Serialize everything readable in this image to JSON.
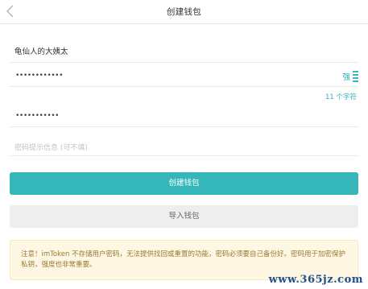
{
  "nav": {
    "back_icon": "chevron-left-icon",
    "title": "创建钱包"
  },
  "form": {
    "wallet_name_value": "龟仙人的大姨太",
    "password_value": "••••••••••••",
    "password_strength_label": "强",
    "password_strength_level": "4/4",
    "char_count": "11 个字符",
    "confirm_password_value": "•••••••••••",
    "hint_placeholder": "密码提示信息 (可不填)"
  },
  "buttons": {
    "create": "创建钱包",
    "import": "导入钱包"
  },
  "notice": {
    "text": "注意！imToken 不存储用户密码，无法提供找回或重置的功能，密码必须要自己备份好。密码用于加密保护私钥，强度也非常重要。"
  },
  "watermark": "www.365jz.com",
  "colors": {
    "accent": "#35b6b9",
    "notice_bg": "#fdf7e3",
    "notice_text": "#9a7a32"
  }
}
